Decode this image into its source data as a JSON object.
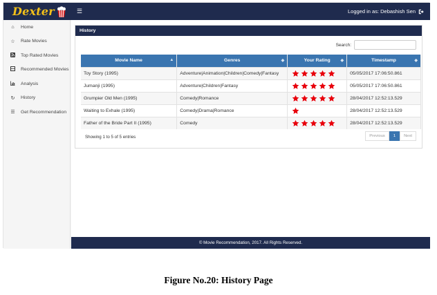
{
  "brand": {
    "name": "Dexter"
  },
  "header": {
    "login_text": "Logged in as: Debashish Sen",
    "menu_icon": "hamburger-icon",
    "logout_icon": "sign-out-icon"
  },
  "sidebar": {
    "items": [
      {
        "label": "Home",
        "icon": "home-icon"
      },
      {
        "label": "Rate Movies",
        "icon": "star-half-icon"
      },
      {
        "label": "Top Rated Movies",
        "icon": "rss-icon"
      },
      {
        "label": "Recommended Movies",
        "icon": "film-icon"
      },
      {
        "label": "Analysis",
        "icon": "bar-chart-icon"
      },
      {
        "label": "History",
        "icon": "history-icon"
      },
      {
        "label": "Get Recommendation",
        "icon": "list-icon"
      }
    ]
  },
  "panel": {
    "title": "History"
  },
  "search": {
    "label": "Search:",
    "value": ""
  },
  "table": {
    "columns": [
      "Movie Name",
      "Genres",
      "Your Rating",
      "Timestamp"
    ],
    "rows": [
      {
        "movie": "Toy Story (1995)",
        "genres": "Adventure|Animation|Children|Comedy|Fantasy",
        "rating": 5,
        "timestamp": "05/05/2017 17:06:50.861"
      },
      {
        "movie": "Jumanji (1995)",
        "genres": "Adventure|Children|Fantasy",
        "rating": 5,
        "timestamp": "05/05/2017 17:06:50.861"
      },
      {
        "movie": "Grumpier Old Men (1995)",
        "genres": "Comedy|Romance",
        "rating": 5,
        "timestamp": "28/04/2017 12:52:13.529"
      },
      {
        "movie": "Waiting to Exhale (1995)",
        "genres": "Comedy|Drama|Romance",
        "rating": 1,
        "timestamp": "28/04/2017 12:52:13.529"
      },
      {
        "movie": "Father of the Bride Part II (1995)",
        "genres": "Comedy",
        "rating": 5,
        "timestamp": "28/04/2017 12:52:13.529"
      }
    ]
  },
  "info": {
    "text": "Showing 1 to 5 of 5 entries"
  },
  "pagination": {
    "previous": "Previous",
    "current": "1",
    "next": "Next"
  },
  "footer": {
    "text": "© Movie Recommendation, 2017. All Rights Reserved."
  },
  "caption": {
    "text": "Figure No.20: History Page"
  },
  "colors": {
    "navbar": "#1f2b4e",
    "table_header": "#3a75b0",
    "star": "#e8000b",
    "brand": "#f2c01a"
  }
}
